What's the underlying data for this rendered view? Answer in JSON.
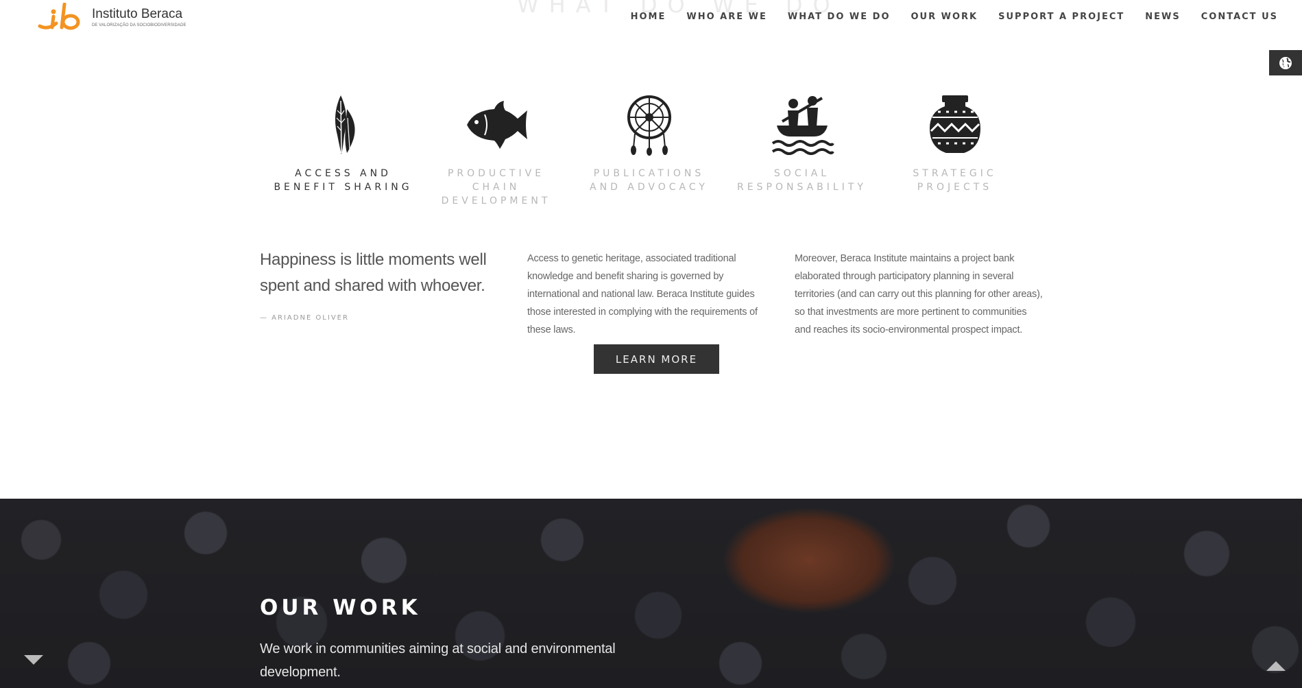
{
  "header": {
    "logo_name": "Instituto Beraca",
    "logo_sub": "DE VALORIZAÇÃO DA SOCIOBIODIVERSIDADE",
    "ghost_title": "WHAT DO WE DO",
    "nav": [
      {
        "label": "HOME"
      },
      {
        "label": "WHO ARE WE"
      },
      {
        "label": "WHAT DO WE DO"
      },
      {
        "label": "OUR WORK"
      },
      {
        "label": "SUPPORT A PROJECT"
      },
      {
        "label": "NEWS"
      },
      {
        "label": "CONTACT US"
      }
    ],
    "language_icon": "globe-icon"
  },
  "features": [
    {
      "label": "ACCESS AND BENEFIT SHARING",
      "icon": "feathers-icon",
      "active": true
    },
    {
      "label": "PRODUCTIVE CHAIN DEVELOPMENT",
      "icon": "fish-icon",
      "active": false
    },
    {
      "label": "PUBLICATIONS AND ADVOCACY",
      "icon": "dreamcatcher-icon",
      "active": false
    },
    {
      "label": "SOCIAL RESPONSABILITY",
      "icon": "canoe-icon",
      "active": false
    },
    {
      "label": "STRATEGIC PROJECTS",
      "icon": "vase-icon",
      "active": false
    }
  ],
  "quote": {
    "text": "Happiness is little moments well spent and shared with whoever.",
    "author": "—  ARIADNE OLIVER"
  },
  "columns": {
    "col1": "Access to genetic heritage, associated traditional knowledge and benefit sharing is governed by international and national law. Beraca Institute guides those interested in complying with the requirements of these laws.",
    "col2": "Moreover, Beraca Institute maintains a project bank elaborated through participatory planning in several territories (and can carry out this planning for other areas), so that investments are more pertinent to communities and reaches its socio-environmental prospect impact."
  },
  "learn_more_label": "LEARN MORE",
  "our_work": {
    "title": "OUR WORK",
    "text": "We work in communities aiming at social and environmental development."
  },
  "colors": {
    "logo_orange": "#f39322",
    "dark_button": "#333333",
    "inactive_label": "#b7b7b7"
  }
}
